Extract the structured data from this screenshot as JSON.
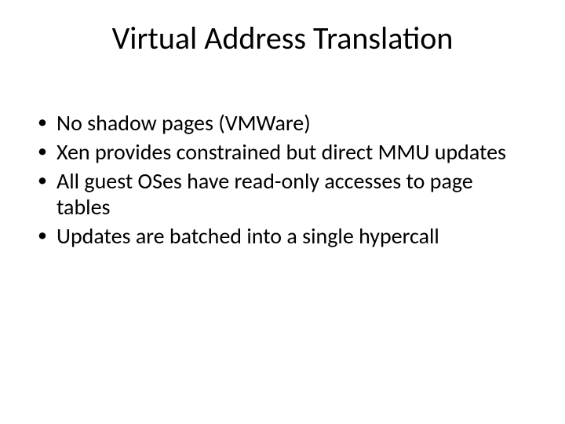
{
  "title": "Virtual Address Translation",
  "bullets": [
    "No shadow pages (VMWare)",
    "Xen provides constrained but direct MMU updates",
    "All guest OSes have read-only accesses to page tables",
    "Updates are batched into a single hypercall"
  ]
}
